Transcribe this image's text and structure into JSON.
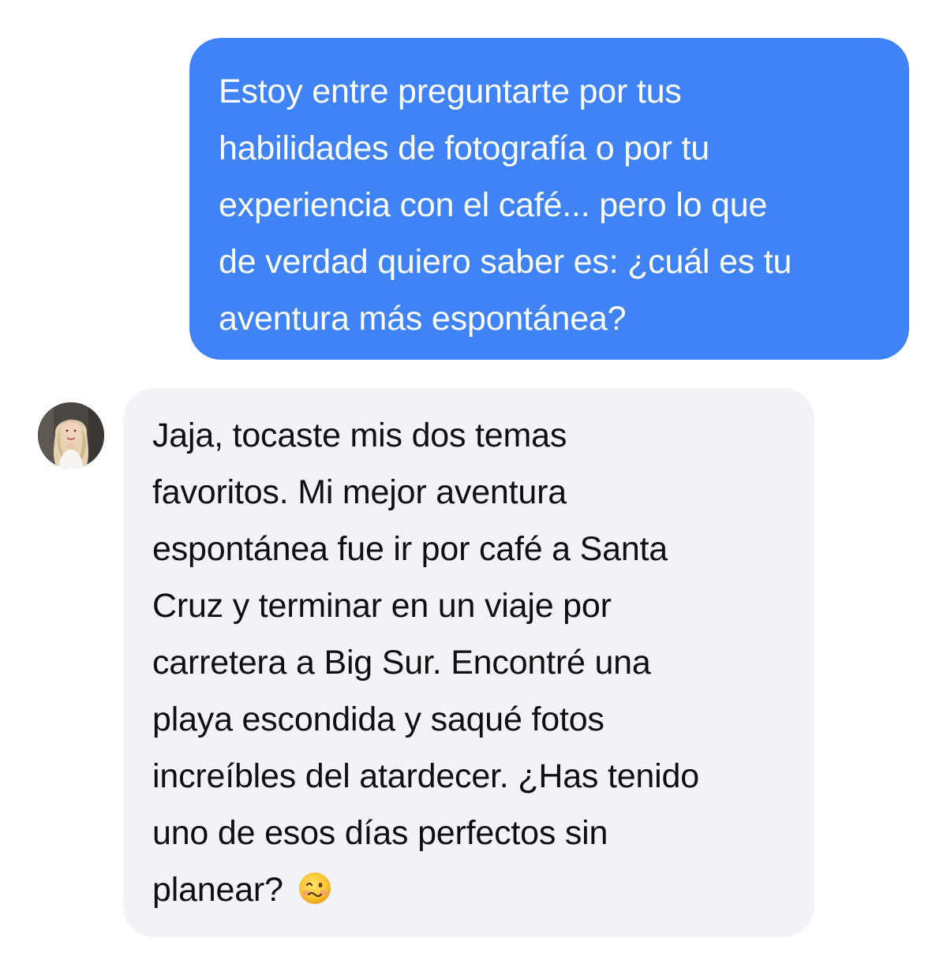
{
  "outgoing_message": {
    "lines": [
      "Estoy entre preguntarte por tus",
      "habilidades de fotografía o por tu",
      "experiencia con el café... pero lo que",
      "de verdad quiero saber es: ¿cuál es tu",
      "aventura más espontánea?"
    ]
  },
  "incoming_message": {
    "avatar": "profile-photo-woman-blonde",
    "lines": [
      "Jaja, tocaste mis dos temas",
      "favoritos. Mi mejor aventura",
      "espontánea fue ir por café a Santa",
      "Cruz y terminar en un viaje por",
      "carretera a Big Sur. Encontré una",
      "playa escondida y saqué fotos",
      "increíbles del atardecer. ¿Has tenido",
      "uno de esos días perfectos sin",
      "planear?"
    ],
    "emoji": "woozy-face-emoji"
  },
  "colors": {
    "outgoing_bubble": "#3f83f6",
    "incoming_bubble": "#f2f3f7",
    "outgoing_text": "#ffffff",
    "incoming_text": "#101013"
  }
}
